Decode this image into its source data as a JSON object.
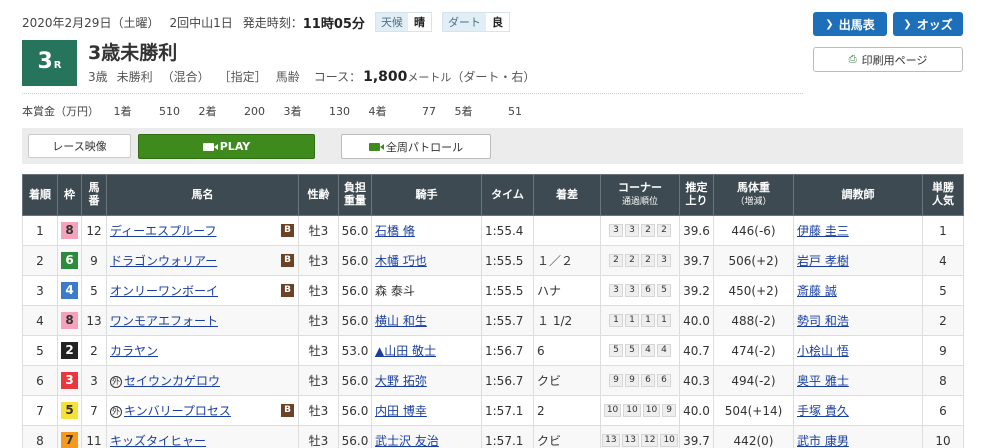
{
  "header": {
    "date": "2020年2月29日（土曜）",
    "meeting": "2回中山1日",
    "post_time_label": "発走時刻：",
    "post_time": "11時05分",
    "weather_label": "天候",
    "weather": "晴",
    "track_label": "ダート",
    "track_condition": "良"
  },
  "race": {
    "number": "3",
    "number_suffix": "R",
    "name": "3歳未勝利",
    "conditions": [
      "3歳",
      "未勝利",
      "（混合）",
      "［指定］",
      "馬齢"
    ],
    "course_label": "コース：",
    "distance": "1,800",
    "distance_unit": "メートル",
    "course_detail": "（ダート・右）"
  },
  "prize": {
    "label": "本賞金（万円）",
    "items": [
      {
        "place": "1着",
        "amount": "510"
      },
      {
        "place": "2着",
        "amount": "200"
      },
      {
        "place": "3着",
        "amount": "130"
      },
      {
        "place": "4着",
        "amount": "77"
      },
      {
        "place": "5着",
        "amount": "51"
      }
    ]
  },
  "buttons": {
    "entries": "出馬表",
    "odds": "オッズ",
    "print": "印刷用ページ",
    "video_label": "レース映像",
    "play": "PLAY",
    "patrol": "全周パトロール"
  },
  "colors": {
    "accent_blue": "#1d6fb9",
    "race_green": "#26745c",
    "play_green": "#3f8a1d",
    "header_dark": "#3e4a51"
  },
  "table": {
    "headers": {
      "place": "着順",
      "frame": "枠",
      "num_1": "馬",
      "num_2": "番",
      "horse": "馬名",
      "sexage": "性齢",
      "weight_1": "負担",
      "weight_2": "重量",
      "jockey": "騎手",
      "time": "タイム",
      "margin": "着差",
      "corner_1": "コーナー",
      "corner_2": "通過順位",
      "last_1": "推定",
      "last_2": "上り",
      "bw_1": "馬体重",
      "bw_2": "（増減）",
      "trainer": "調教師",
      "pop_1": "単勝",
      "pop_2": "人気"
    },
    "rows": [
      {
        "place": "1",
        "frame": "8",
        "num": "12",
        "mark": "",
        "horse": "ディーエスプルーフ",
        "blinker": "B",
        "sexage": "牡3",
        "weight": "56.0",
        "jockey_mark": "",
        "jockey": "石橋 脩",
        "time": "1:55.4",
        "margin": "",
        "corners": [
          "3",
          "3",
          "2",
          "2"
        ],
        "last3f": "39.6",
        "body_weight": "446",
        "weight_change": "(-6)",
        "trainer": "伊藤 圭三",
        "popularity": "1"
      },
      {
        "place": "2",
        "frame": "6",
        "num": "9",
        "mark": "",
        "horse": "ドラゴンウォリアー",
        "blinker": "B",
        "sexage": "牡3",
        "weight": "56.0",
        "jockey_mark": "",
        "jockey": "木幡 巧也",
        "time": "1:55.5",
        "margin": "１／２",
        "corners": [
          "2",
          "2",
          "2",
          "3"
        ],
        "last3f": "39.7",
        "body_weight": "506",
        "weight_change": "(+2)",
        "trainer": "岩戸 孝樹",
        "popularity": "4"
      },
      {
        "place": "3",
        "frame": "4",
        "num": "5",
        "mark": "",
        "horse": "オンリーワンボーイ",
        "blinker": "B",
        "sexage": "牡3",
        "weight": "56.0",
        "jockey_mark": "",
        "jockey": "森 泰斗",
        "time": "1:55.5",
        "margin": "ハナ",
        "corners": [
          "3",
          "3",
          "6",
          "5"
        ],
        "last3f": "39.2",
        "body_weight": "450",
        "weight_change": "(+2)",
        "trainer": "斎藤 誠",
        "popularity": "5"
      },
      {
        "place": "4",
        "frame": "8",
        "num": "13",
        "mark": "",
        "horse": "ワンモアエフォート",
        "blinker": "",
        "sexage": "牡3",
        "weight": "56.0",
        "jockey_mark": "",
        "jockey": "横山 和生",
        "time": "1:55.7",
        "margin": "１ 1/2",
        "corners": [
          "1",
          "1",
          "1",
          "1"
        ],
        "last3f": "40.0",
        "body_weight": "488",
        "weight_change": "(-2)",
        "trainer": "勢司 和浩",
        "popularity": "2"
      },
      {
        "place": "5",
        "frame": "2",
        "num": "2",
        "mark": "",
        "horse": "カラヤン",
        "blinker": "",
        "sexage": "牡3",
        "weight": "53.0",
        "jockey_mark": "▲",
        "jockey": "山田 敬士",
        "time": "1:56.7",
        "margin": "6",
        "corners": [
          "5",
          "5",
          "4",
          "4"
        ],
        "last3f": "40.7",
        "body_weight": "474",
        "weight_change": "(-2)",
        "trainer": "小桧山 悟",
        "popularity": "9"
      },
      {
        "place": "6",
        "frame": "3",
        "num": "3",
        "mark": "外",
        "horse": "セイウンカゲロウ",
        "blinker": "",
        "sexage": "牡3",
        "weight": "56.0",
        "jockey_mark": "",
        "jockey": "大野 拓弥",
        "time": "1:56.7",
        "margin": "クビ",
        "corners": [
          "9",
          "9",
          "6",
          "6"
        ],
        "last3f": "40.3",
        "body_weight": "494",
        "weight_change": "(-2)",
        "trainer": "奥平 雅士",
        "popularity": "8"
      },
      {
        "place": "7",
        "frame": "5",
        "num": "7",
        "mark": "外",
        "horse": "キンバリープロセス",
        "blinker": "B",
        "sexage": "牡3",
        "weight": "56.0",
        "jockey_mark": "",
        "jockey": "内田 博幸",
        "time": "1:57.1",
        "margin": "2",
        "corners": [
          "10",
          "10",
          "10",
          "9"
        ],
        "last3f": "40.0",
        "body_weight": "504",
        "weight_change": "(+14)",
        "trainer": "手塚 貴久",
        "popularity": "6"
      },
      {
        "place": "8",
        "frame": "7",
        "num": "11",
        "mark": "",
        "horse": "キッズタイヒャー",
        "blinker": "",
        "sexage": "牡3",
        "weight": "56.0",
        "jockey_mark": "",
        "jockey": "武士沢 友治",
        "time": "1:57.1",
        "margin": "クビ",
        "corners": [
          "13",
          "13",
          "12",
          "10"
        ],
        "last3f": "39.7",
        "body_weight": "442",
        "weight_change": "(0)",
        "trainer": "武市 康男",
        "popularity": "10"
      }
    ]
  }
}
